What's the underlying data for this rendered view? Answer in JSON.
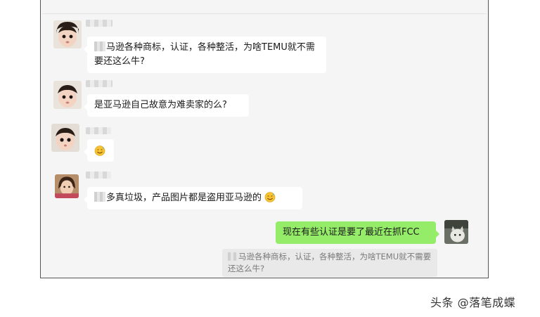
{
  "messages": [
    {
      "side": "left",
      "text": "马逊各种商标，认证，各种整活，为啥TEMU就不需要还这么牛?"
    },
    {
      "side": "left",
      "text": "是亚马逊自己故意为难卖家的么?"
    },
    {
      "side": "left",
      "emoji": "sweat-smile-icon"
    },
    {
      "side": "left",
      "text": "多真垃圾，产品图片都是盗用亚马逊的"
    },
    {
      "side": "right",
      "text": "现在有些认证是要了最近在抓FCC"
    }
  ],
  "quote": {
    "text": "马逊各种商标，认证，各种整活，为啥TEMU就不需要还这么牛?"
  },
  "watermark": "头条 @落笔成蝶",
  "colors": {
    "self_bubble": "#95ec69",
    "other_bubble": "#ffffff",
    "chat_bg": "#f5f5f5"
  }
}
